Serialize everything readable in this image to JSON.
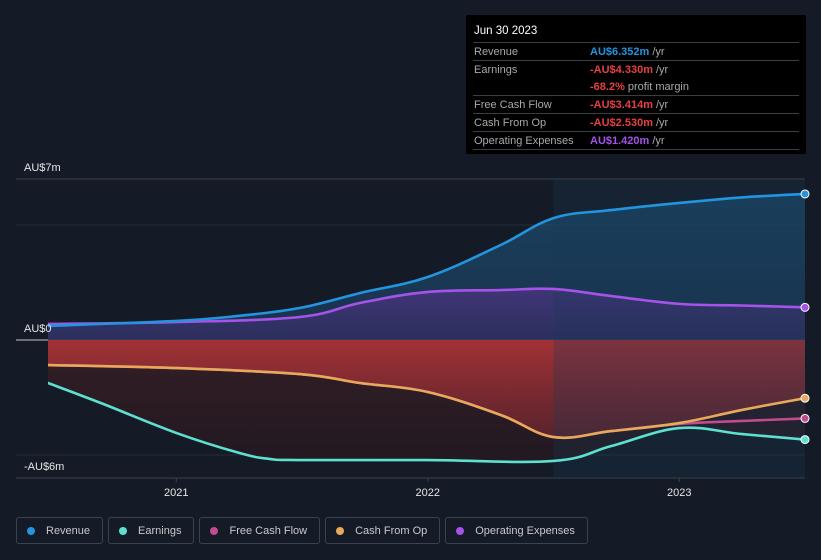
{
  "tooltip": {
    "date": "Jun 30 2023",
    "rows": [
      {
        "label": "Revenue",
        "value": "AU$6.352m",
        "unit": "/yr",
        "color": "#2394df"
      },
      {
        "label": "Earnings",
        "value": "-AU$4.330m",
        "unit": "/yr",
        "color": "#e64141"
      },
      {
        "label": "",
        "value": "-68.2%",
        "unit": "profit margin",
        "color": "#e64141"
      },
      {
        "label": "Free Cash Flow",
        "value": "-AU$3.414m",
        "unit": "/yr",
        "color": "#e64141"
      },
      {
        "label": "Cash From Op",
        "value": "-AU$2.530m",
        "unit": "/yr",
        "color": "#e64141"
      },
      {
        "label": "Operating Expenses",
        "value": "AU$1.420m",
        "unit": "/yr",
        "color": "#a553e8"
      }
    ]
  },
  "legend": [
    {
      "label": "Revenue",
      "color": "#2394df"
    },
    {
      "label": "Earnings",
      "color": "#5de0cf"
    },
    {
      "label": "Free Cash Flow",
      "color": "#c24a8f"
    },
    {
      "label": "Cash From Op",
      "color": "#e8a95a"
    },
    {
      "label": "Operating Expenses",
      "color": "#a553e8"
    }
  ],
  "chart_data": {
    "type": "line",
    "title": "",
    "xlabel": "",
    "ylabel": "",
    "currency": "AU$",
    "units": "millions",
    "ylim": [
      -6,
      7
    ],
    "xlim": [
      2020.49,
      2023.5
    ],
    "y_tick_labels": [
      {
        "value": 7,
        "label": "AU$7m"
      },
      {
        "value": 0,
        "label": "AU$0"
      },
      {
        "value": -6,
        "label": "-AU$6m"
      }
    ],
    "y_gridlines": [
      7,
      5,
      0,
      -5,
      -6
    ],
    "x_tick_labels": [
      {
        "value": 2021,
        "label": "2021"
      },
      {
        "value": 2022,
        "label": "2022"
      },
      {
        "value": 2023,
        "label": "2023"
      }
    ],
    "highlight_start": 2022.5,
    "grid": true,
    "legend_position": "bottom-left",
    "series": [
      {
        "name": "Revenue",
        "color": "#2394df",
        "x": [
          2020.49,
          2021.0,
          2021.25,
          2021.49,
          2021.73,
          2022.0,
          2022.29,
          2022.5,
          2022.73,
          2023.0,
          2023.25,
          2023.5
        ],
        "y": [
          0.61,
          0.83,
          1.05,
          1.39,
          2.04,
          2.74,
          4.13,
          5.3,
          5.65,
          5.96,
          6.2,
          6.35
        ]
      },
      {
        "name": "Earnings",
        "color": "#5de0cf",
        "x": [
          2020.49,
          2020.7,
          2021.0,
          2021.25,
          2021.37,
          2021.49,
          2022.0,
          2022.5,
          2022.73,
          2023.0,
          2023.25,
          2023.5
        ],
        "y": [
          -1.87,
          -2.74,
          -4.04,
          -4.91,
          -5.17,
          -5.22,
          -5.22,
          -5.26,
          -4.61,
          -3.83,
          -4.09,
          -4.33
        ]
      },
      {
        "name": "Free Cash Flow",
        "color": "#c24a8f",
        "x": [
          2020.49,
          2021.0,
          2021.49,
          2021.73,
          2022.0,
          2022.29,
          2022.5,
          2022.73,
          2023.0,
          2023.25,
          2023.5
        ],
        "y": [
          -1.09,
          -1.22,
          -1.48,
          -1.87,
          -2.26,
          -3.26,
          -4.22,
          -3.96,
          -3.65,
          -3.52,
          -3.41
        ]
      },
      {
        "name": "Cash From Op",
        "color": "#e8a95a",
        "x": [
          2020.49,
          2021.0,
          2021.49,
          2021.73,
          2022.0,
          2022.29,
          2022.5,
          2022.73,
          2023.0,
          2023.25,
          2023.5
        ],
        "y": [
          -1.09,
          -1.22,
          -1.48,
          -1.87,
          -2.26,
          -3.26,
          -4.22,
          -3.96,
          -3.61,
          -3.04,
          -2.53
        ]
      },
      {
        "name": "Operating Expenses",
        "color": "#a553e8",
        "x": [
          2020.49,
          2021.0,
          2021.49,
          2021.73,
          2022.0,
          2022.29,
          2022.5,
          2022.73,
          2023.0,
          2023.25,
          2023.5
        ],
        "y": [
          0.7,
          0.78,
          1.0,
          1.61,
          2.09,
          2.17,
          2.22,
          1.91,
          1.57,
          1.5,
          1.42
        ]
      }
    ]
  }
}
